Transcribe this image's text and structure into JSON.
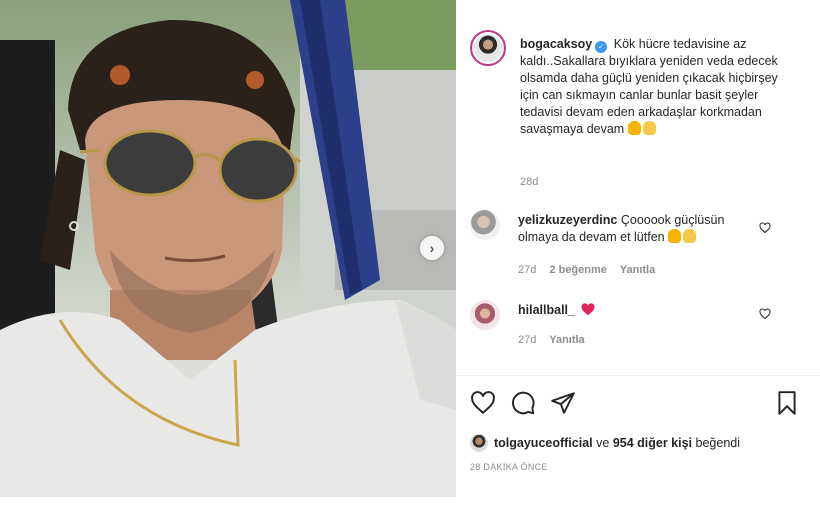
{
  "post": {
    "username": "bogacaksoy",
    "caption": "Kök hücre tedavisine az kaldı..Sakallara bıyıklara yeniden veda edecek olsamda daha güçlü yeniden çıkacak hiçbirşey için can sıkmayın canlar bunlar basit şeyler tedavisi devam eden arkadaşlar korkmadan savaşmaya devam",
    "time": "28d"
  },
  "comments": [
    {
      "username": "yelizkuzeyerdinc",
      "text": "Çoooook güçlüsün olmaya da devam et lütfen",
      "time": "27d",
      "likes": "2 beğenme",
      "reply": "Yanıtla"
    },
    {
      "username": "hilallball_",
      "text": "",
      "time": "27d",
      "reply": "Yanıtla"
    }
  ],
  "liked_by": {
    "user": "tolgayuceofficial",
    "connector": "ve",
    "others": "954 diğer kişi",
    "suffix": "beğendi"
  },
  "timestamp": "28 DAKİKA ÖNCE",
  "icons": {
    "like": "heart-icon",
    "comment": "comment-icon",
    "share": "share-icon",
    "save": "bookmark-icon",
    "verified": "verified-icon",
    "next": "chevron-right-icon"
  },
  "colors": {
    "verified": "#3897f0",
    "heart_red": "#ed4956",
    "muted": "#8e8e8e",
    "text": "#262626"
  }
}
